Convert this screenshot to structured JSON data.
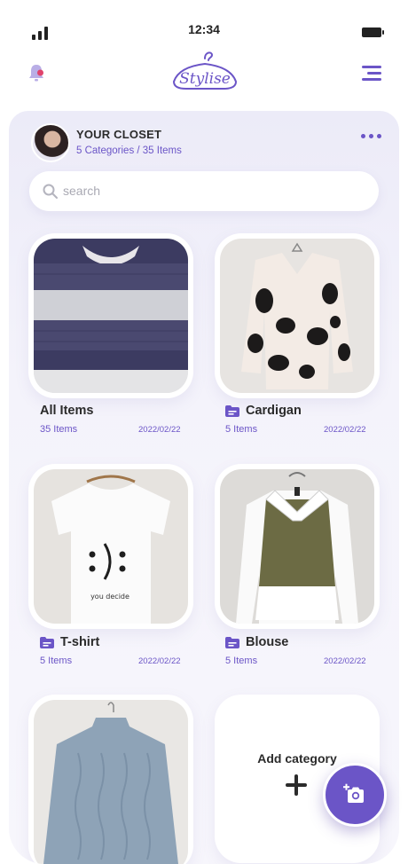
{
  "status_bar": {
    "time": "12:34"
  },
  "header": {
    "logo_text": "Stylise",
    "icons": [
      "bell-icon",
      "hanger-logo-icon",
      "menu-icon"
    ]
  },
  "closet": {
    "title": "YOUR CLOSET",
    "subtitle": "5 Categories / 35 Items"
  },
  "search": {
    "placeholder": "search"
  },
  "categories": [
    {
      "name": "All Items",
      "count": "35 Items",
      "date": "2022/02/22",
      "icon": "none"
    },
    {
      "name": "Cardigan",
      "count": "5 Items",
      "date": "2022/02/22",
      "icon": "folder-icon"
    },
    {
      "name": "T-shirt",
      "count": "5 Items",
      "date": "2022/02/22",
      "icon": "folder-icon"
    },
    {
      "name": "Blouse",
      "count": "5 Items",
      "date": "2022/02/22",
      "icon": "folder-icon"
    }
  ],
  "tshirt_print": "you decide",
  "add_category": {
    "label": "Add category"
  },
  "colors": {
    "accent": "#6b55c7",
    "panel": "#f2f1fa"
  }
}
